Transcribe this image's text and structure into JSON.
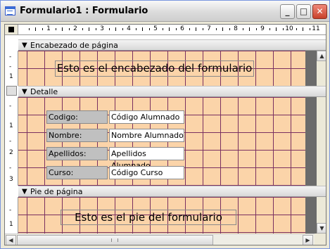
{
  "window": {
    "title": "Formulario1 : Formulario"
  },
  "ruler": {
    "numbers": [
      "1",
      "2",
      "3",
      "4",
      "5",
      "6",
      "7",
      "8",
      "9",
      "10",
      "11"
    ]
  },
  "vruler": {
    "header": [
      "-",
      "-",
      "1"
    ],
    "detail": [
      "-",
      "1",
      "-",
      "2",
      "-",
      "3"
    ],
    "footer": [
      "-",
      "1"
    ]
  },
  "sections": {
    "header": {
      "label": "Encabezado de página",
      "text": "Esto es el encabezado del formulario"
    },
    "detail": {
      "label": "Detalle",
      "fields": [
        {
          "label": "Codigo:",
          "value": "Código Alumnado"
        },
        {
          "label": "Nombre:",
          "value": "Nombre Alumnado"
        },
        {
          "label": "Apellidos:",
          "value": "Apellidos Alumnado"
        },
        {
          "label": "Curso:",
          "value": "Código Curso"
        }
      ]
    },
    "footer": {
      "label": "Pie de página",
      "text": "Esto es el pie del formulario"
    }
  }
}
